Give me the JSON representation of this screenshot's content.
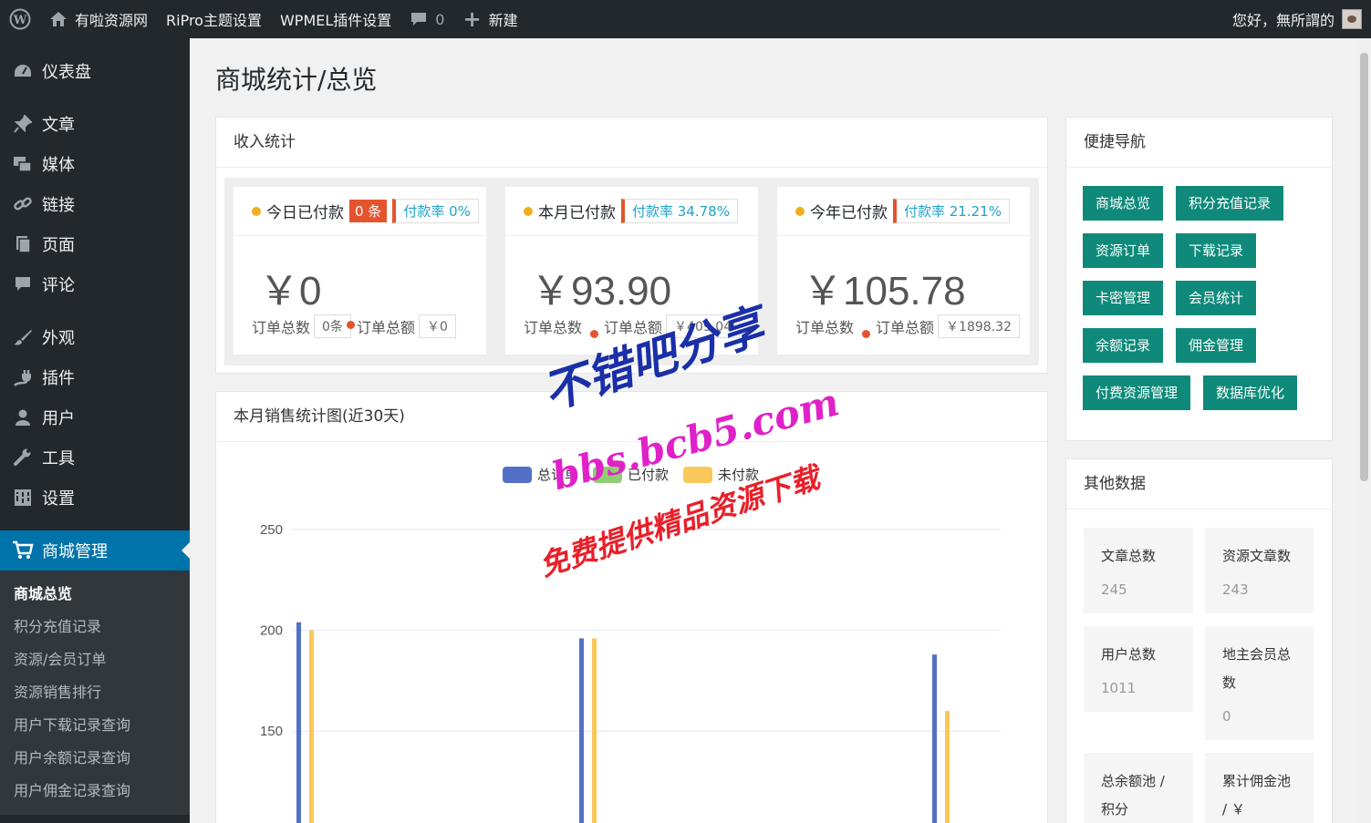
{
  "adminbar": {
    "site_name": "有啦资源网",
    "theme_settings": "RiPro主题设置",
    "plugin_settings": "WPMEL插件设置",
    "comments_count": "0",
    "new_label": "新建",
    "greeting": "您好，無所謂的"
  },
  "sidebar": {
    "items": [
      "仪表盘",
      "文章",
      "媒体",
      "链接",
      "页面",
      "评论",
      "外观",
      "插件",
      "用户",
      "工具",
      "设置"
    ],
    "active": "商城管理",
    "submenu": [
      "商城总览",
      "积分充值记录",
      "资源/会员订单",
      "资源销售排行",
      "用户下载记录查询",
      "用户余额记录查询",
      "用户佣金记录查询"
    ]
  },
  "page": {
    "title": "商城统计/总览"
  },
  "income": {
    "title": "收入统计",
    "cards": [
      {
        "label": "今日已付款",
        "count": "0 条",
        "rate": "付款率 0%",
        "amount": "￥0",
        "orders_label": "订单总数",
        "orders_value": "0条",
        "total_label": "订单总额",
        "total_value": "￥0"
      },
      {
        "label": "本月已付款",
        "count": "",
        "rate": "付款率 34.78%",
        "amount": "￥93.90",
        "orders_label": "订单总数",
        "orders_value": "",
        "total_label": "订单总额",
        "total_value": "￥409.04"
      },
      {
        "label": "今年已付款",
        "count": "",
        "rate": "付款率 21.21%",
        "amount": "￥105.78",
        "orders_label": "订单总数",
        "orders_value": "",
        "total_label": "订单总额",
        "total_value": "￥1898.32"
      }
    ]
  },
  "sales": {
    "title": "本月销售统计图(近30天)"
  },
  "chart_data": {
    "type": "bar",
    "legend_placement": "top-center",
    "grid": true,
    "ylim": [
      100,
      250
    ],
    "yticks": [
      250,
      200,
      150
    ],
    "series": [
      {
        "name": "总订单",
        "color": "#5470c6"
      },
      {
        "name": "已付款",
        "color": "#91cc75"
      },
      {
        "name": "未付款",
        "color": "#fac858"
      }
    ],
    "groups": [
      {
        "total": 204,
        "paid": 0,
        "unpaid": 200
      },
      {
        "total": 196,
        "paid": 0,
        "unpaid": 196
      },
      {
        "total": 188,
        "paid": 0,
        "unpaid": 160
      }
    ]
  },
  "quick_nav": {
    "title": "便捷导航",
    "buttons": [
      "商城总览",
      "积分充值记录",
      "资源订单",
      "下载记录",
      "卡密管理",
      "会员统计",
      "余额记录",
      "佣金管理",
      "付费资源管理",
      "数据库优化"
    ]
  },
  "other": {
    "title": "其他数据",
    "tiles": [
      {
        "label": "文章总数",
        "value": "245"
      },
      {
        "label": "资源文章数",
        "value": "243"
      },
      {
        "label": "用户总数",
        "value": "1011"
      },
      {
        "label": "地主会员总数",
        "value": "0"
      },
      {
        "label": "总余额池 / 积分",
        "value": ""
      },
      {
        "label": "累计佣金池 / ￥",
        "value": ""
      }
    ]
  },
  "watermark": {
    "line1": "不错吧分享",
    "line2": "bbs.bcb5.com",
    "line3": "免费提供精品资源下载"
  }
}
